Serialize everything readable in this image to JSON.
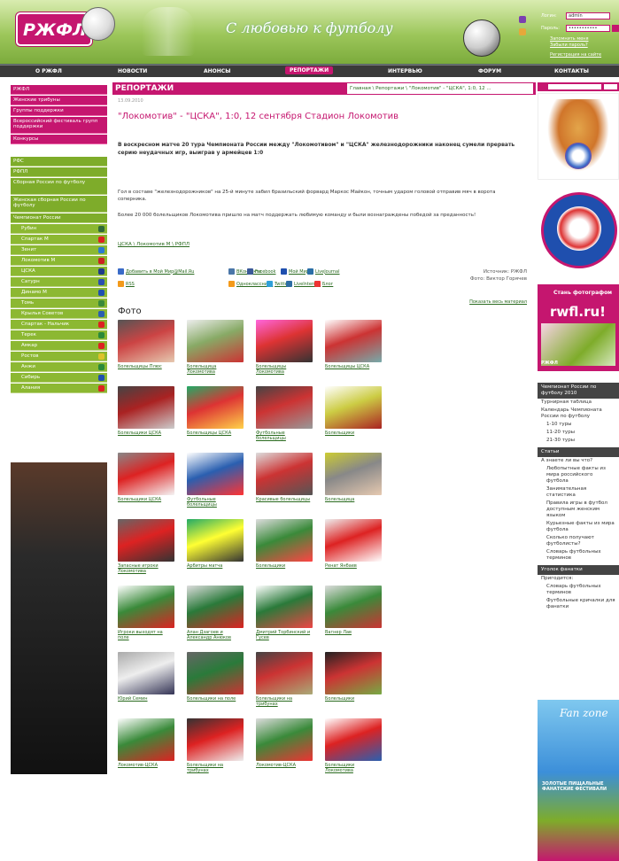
{
  "header": {
    "logo": "РЖФЛ",
    "slogan": "С любовью к футболу",
    "login": {
      "login_label": "Логин:",
      "login_value": "admin",
      "pass_label": "Пароль:",
      "pass_value": "•••••••••••",
      "remember": "Запомнить меня",
      "forgot": "Забыли пароль?",
      "register": "Регистрация на сайте"
    }
  },
  "nav": {
    "items": [
      "О РЖФЛ",
      "НОВОСТИ",
      "АНОНСЫ",
      "РЕПОРТАЖИ",
      "ИНТЕРВЬЮ",
      "ФОРУМ",
      "КОНТАКТЫ"
    ]
  },
  "left_menu": {
    "pink": [
      "РЖФЛ",
      "Женские трибуны",
      "Группы поддержки",
      "Всероссийский фестиваль групп поддержки",
      "Конкурсы"
    ],
    "green": [
      "РФС",
      "РФПЛ",
      "Сборная России по футболу",
      "Женская сборная России по футболу",
      "Чемпионат России"
    ],
    "clubs": [
      "Рубин",
      "Спартак М",
      "Зенит",
      "Локомотив М",
      "ЦСКА",
      "Сатурн",
      "Динамо М",
      "Томь",
      "Крылья Советов",
      "Спартак - Нальчик",
      "Терек",
      "Амкар",
      "Ростов",
      "Анжи",
      "Сибирь",
      "Алания"
    ]
  },
  "main": {
    "section": "РЕПОРТАЖИ",
    "breadcrumb": "Главная \\ Репортажи \\ \"Локомотив\" - \"ЦСКА\", 1:0, 12 ...",
    "date": "13.09.2010",
    "headline": "\"Локомотив\" - \"ЦСКА\", 1:0, 12 сентября Стадион Локомотив",
    "lead": "В воскресном матче 20 тура Чемпионата России между \"Локомотивом\" и \"ЦСКА\" железнодорожники наконец сумели прервать серию неудачных игр, выиграв у армейцев 1:0",
    "body1": "Гол в составе \"железнодорожников\" на 25-й минуте забил бразильский форвард Маркос Майкон, точным ударом головой отправив мяч в ворота соперника.",
    "body2": "Более 20 000 болельщиков Локомотива пришло на матч поддержать любимую команду и были вознаграждены победой за преданность!",
    "tags": "ЦСКА \\ Локомотив М \\ РФПЛ",
    "shares": [
      {
        "label": "Добавить в Мой Мир@Mail.Ru",
        "icon": "myworld-icon",
        "color": "#3a6bc8"
      },
      {
        "label": "RSS",
        "icon": "rss-icon",
        "color": "#f39a1b"
      },
      {
        "label": "ВКонтакте",
        "icon": "vk-icon",
        "color": "#4a76a8"
      },
      {
        "label": "Facebook",
        "icon": "facebook-icon",
        "color": "#3b5998"
      },
      {
        "label": "Мой Мир",
        "icon": "mymir-icon",
        "color": "#1f4fae"
      },
      {
        "label": "LiveJournal",
        "icon": "livejournal-icon",
        "color": "#2a6ea6"
      },
      {
        "label": "Одноклассники",
        "icon": "ok-icon",
        "color": "#f49a1a"
      },
      {
        "label": "Twitter",
        "icon": "twitter-icon",
        "color": "#30a0d8"
      },
      {
        "label": "LiveInternet",
        "icon": "liveinternet-icon",
        "color": "#2d6da3"
      },
      {
        "label": "Блог",
        "icon": "blog-icon",
        "color": "#e33"
      }
    ],
    "source": "Источник: РЖФЛ",
    "photo_credit": "Фото: Виктор Горячев",
    "view_all": "Показать весь материал",
    "photo_title": "Фото",
    "photos": [
      "Болельщицы Плюс",
      "Болельщица Локомотива",
      "Болельщицы Локомотива",
      "Болельщицы ЦСКА",
      "Болельщики ЦСКА",
      "Болельщицы ЦСКА",
      "Футбольные болельщицы",
      "Болельщики",
      "Болельщики ЦСКА",
      "Футбольные болельщицы",
      "Красивые болельщицы",
      "Болельщица",
      "Запасные игроки Локомотива",
      "Арбитры матча",
      "Болельщики",
      "Ренат Янбаев",
      "Игроки выходят на поле",
      "Алан Дзагоев и Александр Анюков",
      "Дмитрий Торбинский и Гусев",
      "Вагнер Лав",
      "Юрий Семин",
      "Болельщики на поле",
      "Болельщики на трибунах",
      "Болельщики",
      "Локомотив-ЦСКА",
      "Болельщики на трибунах",
      "Локомотив-ЦСКА",
      "Болельщики Локомотива"
    ]
  },
  "right": {
    "ad_title": "Стань фотографом",
    "ad_site": "rwfl.ru!",
    "ad_logo": "РЖФЛ",
    "menu1_head": "Чемпионат России по футболу 2010",
    "menu1": [
      "Турнирная таблица",
      "Календарь Чемпионата России по футболу"
    ],
    "menu1_sub": [
      "1-10 туры",
      "11-20 туры",
      "21-30 туры"
    ],
    "menu2_head": "Статьи",
    "menu2": [
      "А знаете ли вы что?"
    ],
    "menu2_sub": [
      "Любопытные факты из мира российского футбола",
      "Занимательная статистика",
      "Правила игры в футбол доступным женским языком",
      "Курьезные факты из мира футбола",
      "Сколько получают футболисты?",
      "Словарь футбольных терминов"
    ],
    "menu3_head": "Уголок фанатки",
    "menu3": [
      "Пригодится:"
    ],
    "menu3_sub": [
      "Словарь футбольных терминов",
      "Футбольные кричалки для фанатки"
    ],
    "banner_logo": "Fan zone",
    "banner_text": "ЗОЛОТЫЕ ПИЩАЛЬНЫЕ ФАНАТСКИЕ ФЕСТИВАЛИ"
  }
}
